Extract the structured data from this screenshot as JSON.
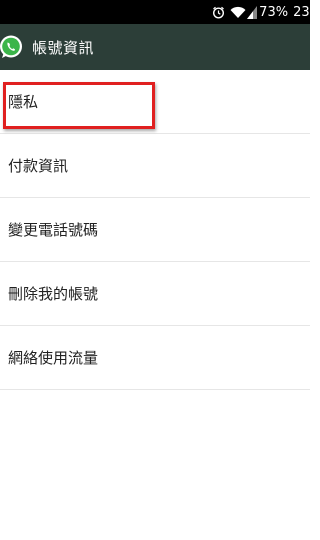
{
  "status_bar": {
    "battery_percent": "73%",
    "time": "23:",
    "icons": [
      "alarm-icon",
      "wifi-icon",
      "signal-icon"
    ]
  },
  "action_bar": {
    "title": "帳號資訊",
    "logo_icon": "whatsapp-logo-icon",
    "background": "#2c3e38"
  },
  "menu": {
    "items": [
      {
        "label": "隱私"
      },
      {
        "label": "付款資訊"
      },
      {
        "label": "變更電話號碼"
      },
      {
        "label": "刪除我的帳號"
      },
      {
        "label": "網絡使用流量"
      }
    ]
  },
  "annotation": {
    "color": "#e02020",
    "target": "隱私"
  }
}
